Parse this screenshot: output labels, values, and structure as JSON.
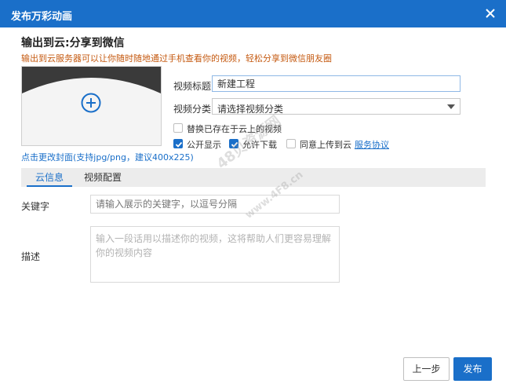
{
  "window": {
    "title": "发布万彩动画"
  },
  "header": {
    "title": "输出到云:分享到微信",
    "subtitle": "输出到云服务器可以让你随时随地通过手机查看你的视频，轻松分享到微信朋友圈"
  },
  "cover": {
    "change_link": "点击更改封面(支持jpg/png，建议400x225)"
  },
  "form": {
    "title_label": "视频标题:",
    "title_value": "新建工程",
    "category_label": "视频分类:",
    "category_value": "请选择视频分类",
    "replace_label": "替换已存在于云上的视频",
    "public_label": "公开显示",
    "download_label": "允许下载",
    "agree_label": "同意上传到云",
    "service_link": "服务协议"
  },
  "tabs": [
    {
      "label": "云信息"
    },
    {
      "label": "视频配置"
    }
  ],
  "fields": {
    "keywords_label": "关键字",
    "keywords_placeholder": "请输入展示的关键字，以逗号分隔",
    "desc_label": "描述",
    "desc_placeholder": "输入一段话用以描述你的视频，这将帮助人们更容易理解你的视频内容"
  },
  "buttons": {
    "prev": "上一步",
    "publish": "发布"
  },
  "watermark": {
    "line1": "48贝资源网",
    "line2": "www.4F8.cn"
  },
  "colors": {
    "accent": "#1a6fc9",
    "warning": "#c55a11"
  }
}
